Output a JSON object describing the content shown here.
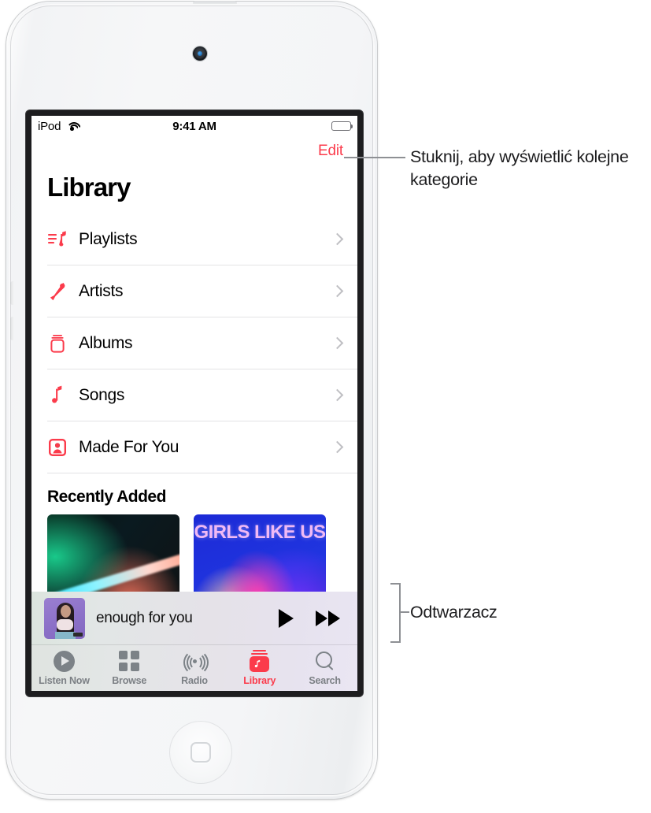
{
  "device": {
    "name": "iPod touch",
    "camera": "front-camera",
    "home_button": "home-button"
  },
  "status_bar": {
    "carrier": "iPod",
    "wifi_icon": "wifi-icon",
    "time": "9:41 AM",
    "battery_icon": "battery-full-icon"
  },
  "nav": {
    "edit_label": "Edit",
    "edit_color": "#fb3b4b"
  },
  "page_title": "Library",
  "library_rows": [
    {
      "label": "Playlists",
      "icon": "playlist-note-icon",
      "chevron": "chevron-right-icon"
    },
    {
      "label": "Artists",
      "icon": "microphone-icon",
      "chevron": "chevron-right-icon"
    },
    {
      "label": "Albums",
      "icon": "album-stack-icon",
      "chevron": "chevron-right-icon"
    },
    {
      "label": "Songs",
      "icon": "music-note-icon",
      "chevron": "chevron-right-icon"
    },
    {
      "label": "Made For You",
      "icon": "person-card-icon",
      "chevron": "chevron-right-icon"
    }
  ],
  "recently_added": {
    "heading": "Recently Added",
    "items": [
      {
        "name": "album-art-neon-light",
        "caption": ""
      },
      {
        "name": "album-art-girls-like-us",
        "caption": "GIRLS LIKE US"
      }
    ]
  },
  "mini_player": {
    "artwork": "now-playing-artwork",
    "title": "enough for you",
    "play_button": "play-icon",
    "next_button": "fast-forward-icon"
  },
  "tab_bar": {
    "active": "Library",
    "active_color": "#fb3b4b",
    "inactive_color": "#7c8085",
    "tabs": [
      {
        "label": "Listen Now",
        "icon": "play-circle-icon"
      },
      {
        "label": "Browse",
        "icon": "grid-squares-icon"
      },
      {
        "label": "Radio",
        "icon": "broadcast-waves-icon"
      },
      {
        "label": "Library",
        "icon": "library-music-icon"
      },
      {
        "label": "Search",
        "icon": "magnifier-icon"
      }
    ]
  },
  "callouts": {
    "edit": "Stuknij, aby wyświetlić kolejne kategorie",
    "player": "Odtwarzacz"
  }
}
